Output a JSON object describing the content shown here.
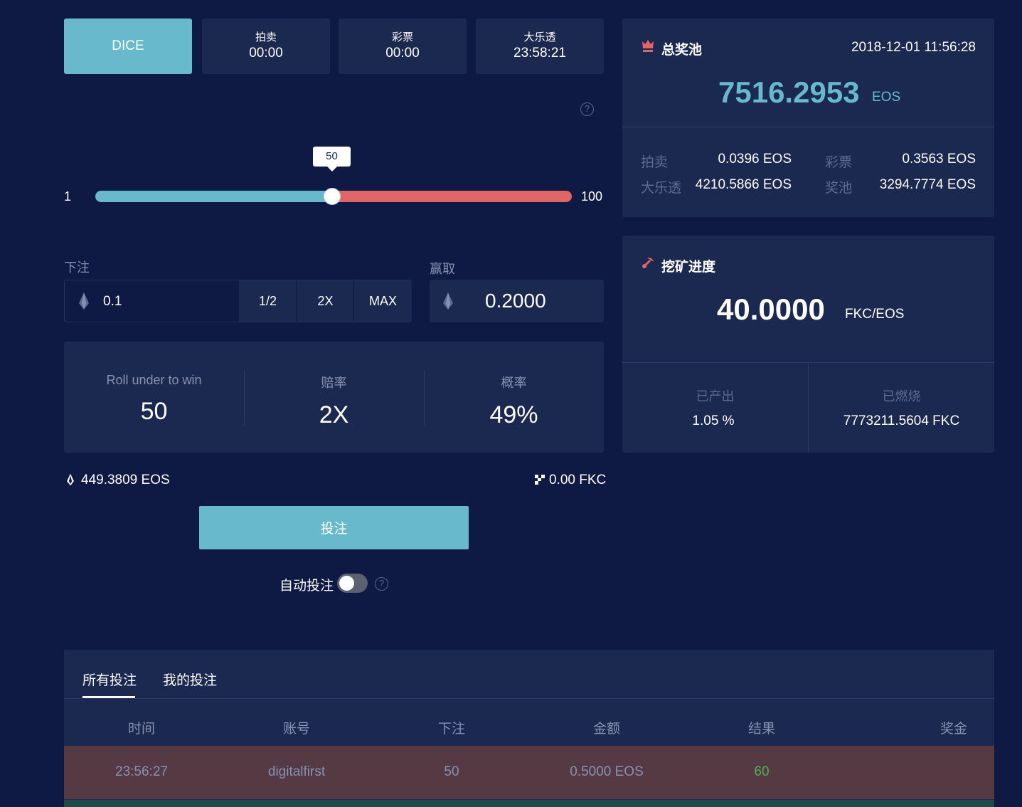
{
  "game_tabs": [
    {
      "label": "DICE",
      "time": ""
    },
    {
      "label": "拍卖",
      "time": "00:00"
    },
    {
      "label": "彩票",
      "time": "00:00"
    },
    {
      "label": "大乐透",
      "time": "23:58:21"
    }
  ],
  "slider": {
    "min": "1",
    "max": "100",
    "value": 50,
    "value_label": "50"
  },
  "bet": {
    "label": "下注",
    "amount": "0.1",
    "half": "1/2",
    "double": "2X",
    "max": "MAX"
  },
  "win": {
    "label": "赢取",
    "amount": "0.2000"
  },
  "stats": {
    "roll_label": "Roll under to win",
    "roll_value": "50",
    "odds_label": "赔率",
    "odds_value": "2X",
    "chance_label": "概率",
    "chance_value": "49%"
  },
  "balance": {
    "eos": "449.3809 EOS",
    "fkc": "0.00 FKC"
  },
  "place_bet_label": "投注",
  "auto_bet": {
    "label": "自动投注",
    "enabled": false
  },
  "pool": {
    "title": "总奖池",
    "datetime": "2018-12-01 11:56:28",
    "total": "7516.2953",
    "unit": "EOS",
    "items": [
      {
        "label": "拍卖",
        "value": "0.0396 EOS"
      },
      {
        "label": "彩票",
        "value": "0.3563 EOS"
      },
      {
        "label": "大乐透",
        "value": "4210.5866 EOS"
      },
      {
        "label": "奖池",
        "value": "3294.7774 EOS"
      }
    ]
  },
  "mining": {
    "title": "挖矿进度",
    "rate": "40.0000",
    "unit": "FKC/EOS",
    "produced_label": "已产出",
    "produced_value": "1.05 %",
    "burned_label": "已燃烧",
    "burned_value": "7773211.5604 FKC"
  },
  "history": {
    "tabs": [
      "所有投注",
      "我的投注"
    ],
    "columns": [
      "时间",
      "账号",
      "下注",
      "金额",
      "结果",
      "奖金"
    ],
    "rows": [
      {
        "time": "23:56:27",
        "account": "digitalfirst",
        "bet": "50",
        "amount": "0.5000 EOS",
        "result": "60",
        "prize": ""
      }
    ]
  },
  "colors": {
    "background": "#0f1a44",
    "panel": "#1b2850",
    "accent": "#67b9cb",
    "danger": "#e06566",
    "result_green": "#4fb04f",
    "lose_row": "#553a44"
  }
}
